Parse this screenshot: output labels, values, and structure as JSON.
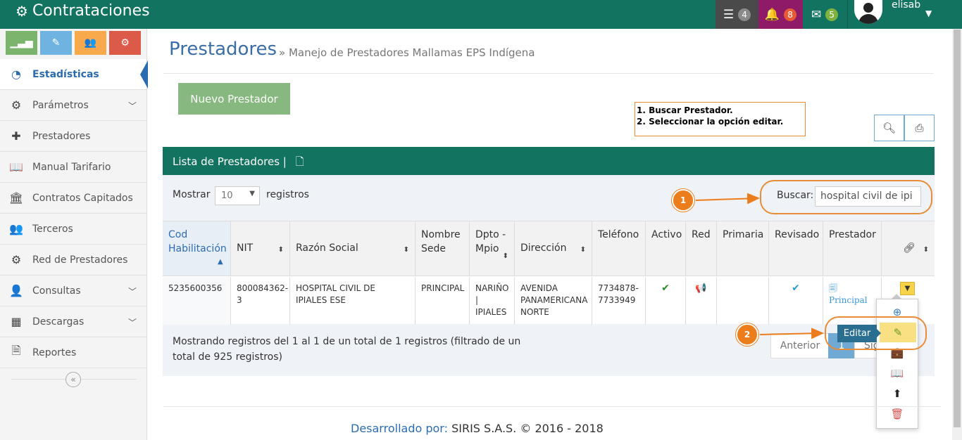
{
  "app": {
    "title": "Contrataciones"
  },
  "topnav": {
    "tasks_count": "4",
    "notifications_count": "8",
    "messages_count": "5",
    "username": "elisab",
    "colors": {
      "bar": "#127460",
      "tasks": "#4a4a4a",
      "notifications": "#8e1a68",
      "messages": "#127460"
    }
  },
  "sidebar": {
    "shortcut_icons": [
      "chart-icon",
      "pencil-icon",
      "users-icon",
      "cogs-icon"
    ],
    "items": [
      {
        "label": "Estadísticas",
        "icon": "dashboard-icon",
        "active": true,
        "expandable": false
      },
      {
        "label": "Parámetros",
        "icon": "cogs-icon",
        "expandable": true
      },
      {
        "label": "Prestadores",
        "icon": "medkit-icon",
        "expandable": false
      },
      {
        "label": "Manual Tarifario",
        "icon": "book-icon",
        "expandable": false
      },
      {
        "label": "Contratos Capitados",
        "icon": "institution-icon",
        "expandable": false
      },
      {
        "label": "Terceros",
        "icon": "users-icon",
        "expandable": false
      },
      {
        "label": "Red de Prestadores",
        "icon": "cogs-icon",
        "expandable": false
      },
      {
        "label": "Consultas",
        "icon": "user-tie-icon",
        "expandable": true
      },
      {
        "label": "Descargas",
        "icon": "cubes-icon",
        "expandable": true
      },
      {
        "label": "Reportes",
        "icon": "excel-file-icon",
        "expandable": false
      }
    ]
  },
  "main": {
    "title": "Prestadores",
    "subtitle": "» Manejo de Prestadores Mallamas EPS Indígena",
    "new_button": "Nuevo Prestador",
    "instructions": [
      "1. Buscar Prestador.",
      "2. Seleccionar la opción editar."
    ],
    "panel_title": "Lista de Prestadores |",
    "length_prefix": "Mostrar",
    "length_value": "10",
    "length_suffix": "registros",
    "search_label": "Buscar:",
    "search_value": "hospital civil de ipi",
    "step1": "1",
    "step2": "2",
    "table": {
      "headers": [
        "Cod Habilitación",
        "NIT",
        "Razón Social",
        "Nombre Sede",
        "Dpto - Mpio",
        "Dirección",
        "Teléfono",
        "Activo",
        "Red",
        "Primaria",
        "Revisado",
        "Prestador",
        ""
      ],
      "row": {
        "cod": "5235600356",
        "nit": "800084362-3",
        "razon": "HOSPITAL CIVIL DE IPIALES ESE",
        "sede": "PRINCIPAL",
        "dpto": "NARIÑO | IPIALES",
        "direccion": "AVENIDA PANAMERICANA NORTE",
        "telefono": "7734878-7733949",
        "activo": "✔",
        "red": "📢",
        "primaria": "",
        "revisado": "✔",
        "prestador": "Principal"
      }
    },
    "info": "Mostrando registros del 1 al 1 de un total de 1 registros (filtrado de un total de 925 registros)",
    "pager": {
      "prev": "Anterior",
      "current": "1",
      "next": "Siguiente"
    },
    "actions_menu": [
      "zoom-icon",
      "pencil-icon",
      "briefcase-icon",
      "book-icon",
      "arrow-up-circle-icon",
      "trash-icon"
    ],
    "tooltip": "Editar"
  },
  "footer": {
    "by": "Desarrollado por:",
    "company": "SIRIS S.A.S. © 2016 - 2018"
  }
}
